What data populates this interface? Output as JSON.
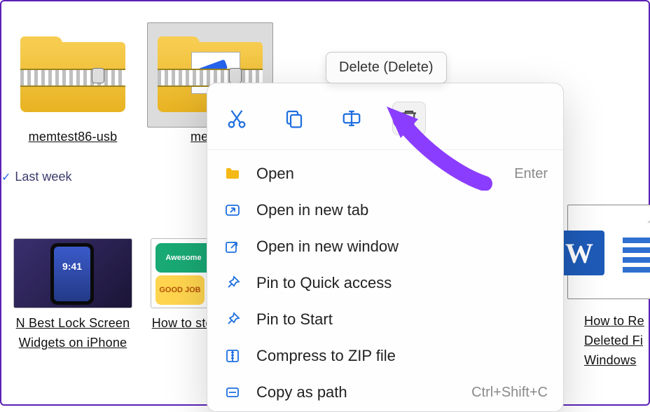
{
  "tooltip": {
    "text": "Delete (Delete)"
  },
  "week_header": {
    "label": "Last week"
  },
  "files": {
    "row1": [
      {
        "label": "memtest86-usb"
      },
      {
        "label": "memte"
      }
    ],
    "row2": [
      {
        "label": "N Best Lock Screen Widgets on iPhone",
        "time": "9:41"
      },
      {
        "label": "How to stom Te s on"
      },
      {
        "label": "How to Re Deleted Fi Windows"
      }
    ],
    "stickers": {
      "a": "Awesome",
      "c": "GOOD JOB"
    }
  },
  "word_badge": "W",
  "ctx": {
    "toolbar": {
      "cut": "cut",
      "copy": "copy",
      "rename": "rename",
      "delete": "delete"
    },
    "items": [
      {
        "label": "Open",
        "shortcut": "Enter",
        "icon": "folder"
      },
      {
        "label": "Open in new tab",
        "shortcut": "",
        "icon": "newtab"
      },
      {
        "label": "Open in new window",
        "shortcut": "",
        "icon": "newwin"
      },
      {
        "label": "Pin to Quick access",
        "shortcut": "",
        "icon": "pin"
      },
      {
        "label": "Pin to Start",
        "shortcut": "",
        "icon": "pin"
      },
      {
        "label": "Compress to ZIP file",
        "shortcut": "",
        "icon": "zip"
      },
      {
        "label": "Copy as path",
        "shortcut": "Ctrl+Shift+C",
        "icon": "path"
      }
    ]
  }
}
